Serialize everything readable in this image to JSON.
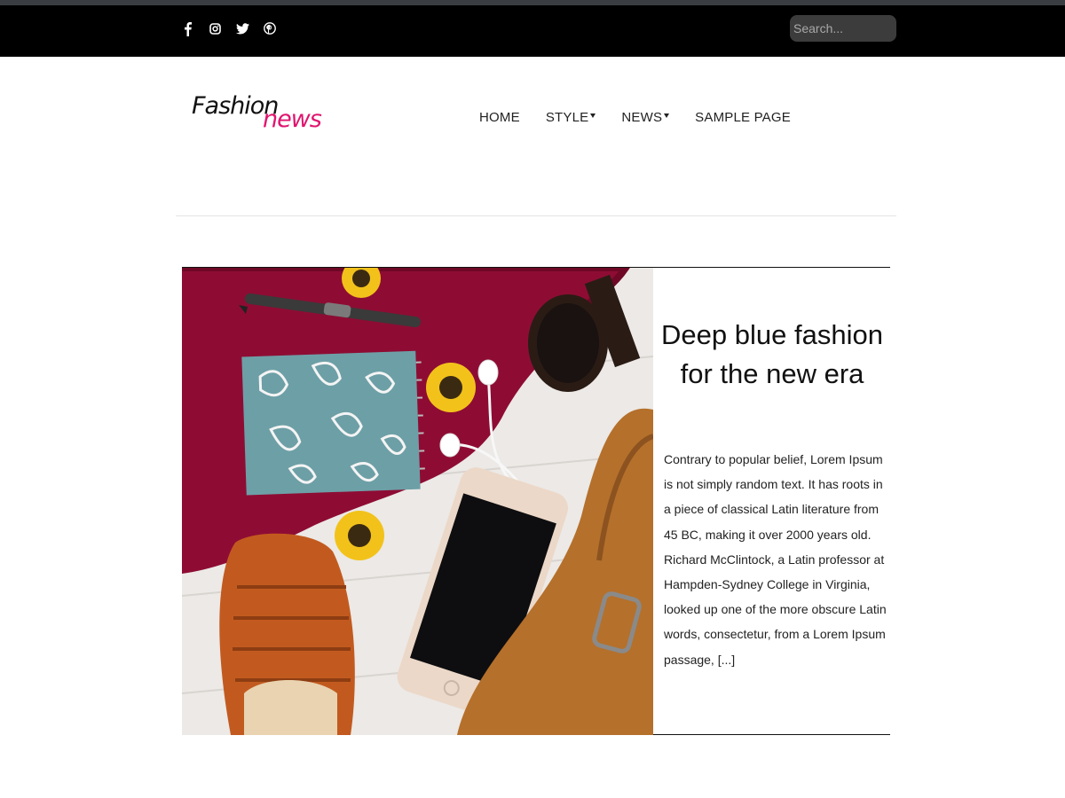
{
  "topbar": {
    "social_icons": [
      "facebook-icon",
      "instagram-icon",
      "twitter-icon",
      "pinterest-icon"
    ],
    "search_placeholder": "Search..."
  },
  "header": {
    "logo": {
      "word1": "Fashion",
      "word2": "news"
    },
    "nav": [
      {
        "label": "HOME",
        "has_dropdown": false
      },
      {
        "label": "STYLE",
        "has_dropdown": true
      },
      {
        "label": "NEWS",
        "has_dropdown": true
      },
      {
        "label": "SAMPLE PAGE",
        "has_dropdown": false
      }
    ]
  },
  "featured": {
    "title": "Deep blue fashion for the new era",
    "excerpt": "Contrary to popular belief, Lorem Ipsum is not simply random text. It has roots in a piece of classical Latin literature from 45 BC, making it over 2000 years old. Richard McClintock, a Latin professor at Hampden-Sydney College in Virginia, looked up one of the more obscure Latin words, consectetur, from a Lorem Ipsum passage, [...]"
  },
  "colors": {
    "topbar_bg": "#000000",
    "logo_accent": "#e0156e",
    "text": "#111111"
  }
}
